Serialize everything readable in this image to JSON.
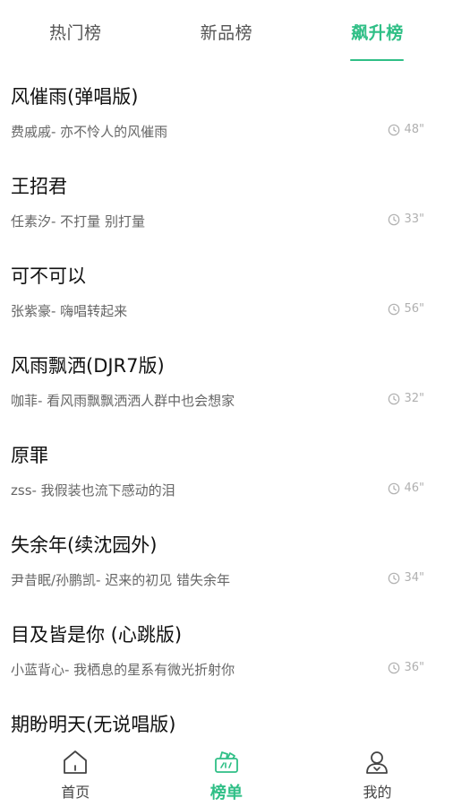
{
  "tabs": [
    {
      "label": "热门榜",
      "active": false
    },
    {
      "label": "新品榜",
      "active": false
    },
    {
      "label": "飙升榜",
      "active": true
    }
  ],
  "songs": [
    {
      "title": "风催雨(弹唱版)",
      "subtitle": "费戚戚- 亦不怜人的风催雨",
      "duration": "48\""
    },
    {
      "title": "王招君",
      "subtitle": "任素汐- 不打量 别打量",
      "duration": "33\""
    },
    {
      "title": "可不可以",
      "subtitle": "张紫豪- 嗨唱转起来",
      "duration": "56\""
    },
    {
      "title": "风雨飘洒(DJR7版)",
      "subtitle": "咖菲- 看风雨飘飘洒洒人群中也会想家",
      "duration": "32\""
    },
    {
      "title": "原罪",
      "subtitle": "zss- 我假装也流下感动的泪",
      "duration": "46\""
    },
    {
      "title": "失余年(续沈园外)",
      "subtitle": "尹昔眠/孙鹏凯- 迟来的初见 错失余年",
      "duration": "34\""
    },
    {
      "title": "目及皆是你 (心跳版)",
      "subtitle": "小蓝背心- 我栖息的星系有微光折射你",
      "duration": "36\""
    },
    {
      "title": "期盼明天(无说唱版)",
      "subtitle": "",
      "duration": ""
    }
  ],
  "bottom_nav": [
    {
      "label": "首页",
      "icon": "home-icon",
      "active": false
    },
    {
      "label": "榜单",
      "icon": "chart-list-icon",
      "active": true
    },
    {
      "label": "我的",
      "icon": "user-icon",
      "active": false
    }
  ],
  "colors": {
    "accent": "#2fbf86",
    "text": "#111111",
    "subtext": "#666666",
    "muted": "#b0b0b0"
  }
}
